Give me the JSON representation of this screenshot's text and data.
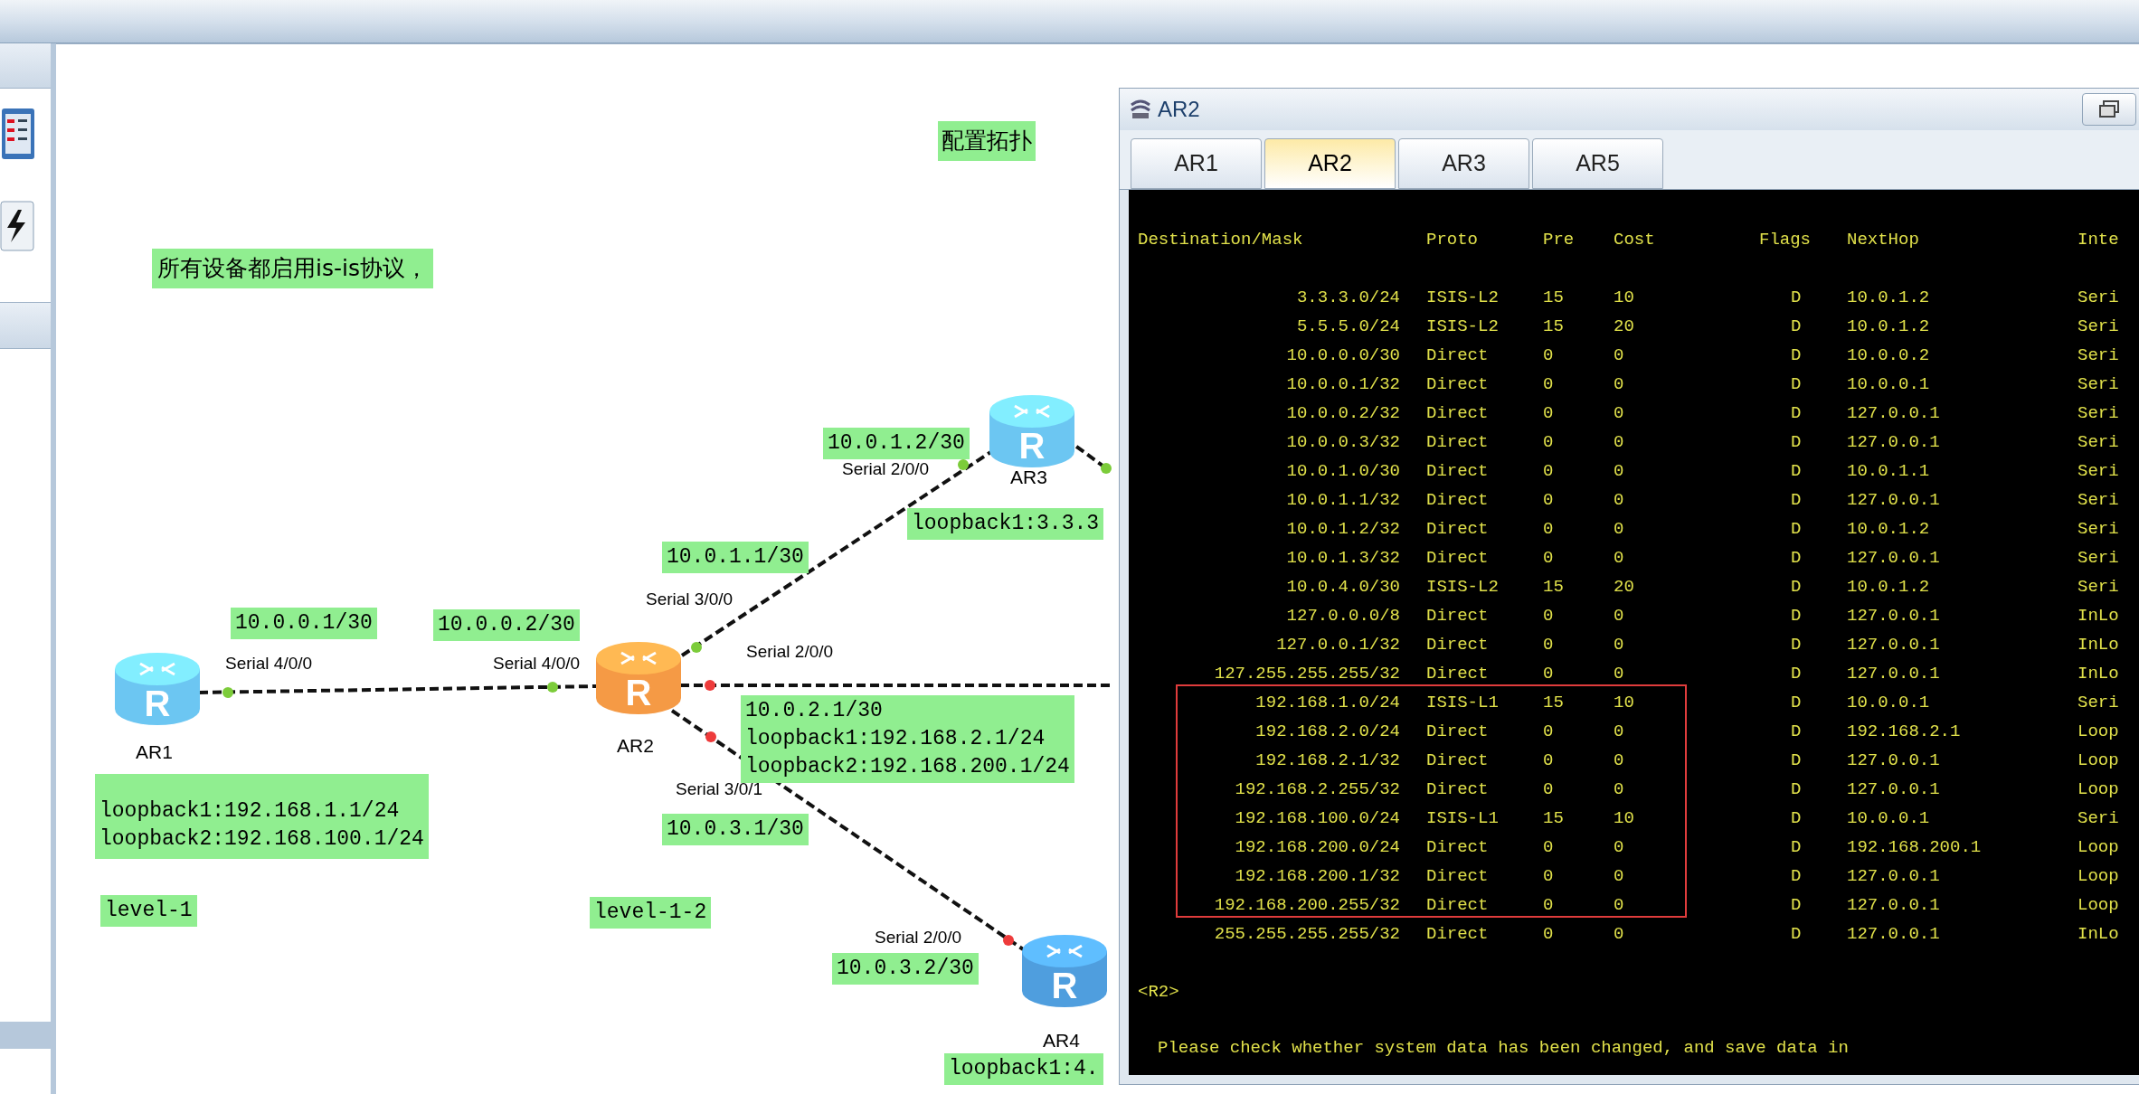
{
  "canvas": {
    "heading": "配置拓扑",
    "note": "所有设备都启用is-is协议，",
    "routers": [
      {
        "name": "AR1",
        "icon_letter": "R",
        "color": "#6cc6f2"
      },
      {
        "name": "AR2",
        "icon_letter": "R",
        "color": "#f59a45"
      },
      {
        "name": "AR3",
        "icon_letter": "R",
        "color": "#6cc6f2"
      },
      {
        "name": "AR4",
        "icon_letter": "R",
        "color": "#4f9ede"
      }
    ],
    "ports": [
      {
        "label": "Serial 4/0/0",
        "color": "#7ccc3a"
      },
      {
        "label": "Serial 4/0/0",
        "color": "#7ccc3a"
      },
      {
        "label": "Serial 3/0/0",
        "color": "#7ccc3a"
      },
      {
        "label": "Serial 2/0/0",
        "color": "#7ccc3a"
      },
      {
        "color": "#7ccc3a"
      },
      {
        "label": "Serial 2/0/0",
        "color": "#ee3b3b"
      },
      {
        "label": "Serial 3/0/1",
        "color": "#ee3b3b"
      },
      {
        "label": "Serial 2/0/0",
        "color": "#ee3b3b"
      }
    ],
    "labels": [
      {
        "lines": [
          "10.0.1.2/30"
        ]
      },
      {
        "lines": [
          "loopback1:3.3.3"
        ]
      },
      {
        "lines": [
          "10.0.1.1/30"
        ]
      },
      {
        "lines": [
          "10.0.0.1/30"
        ]
      },
      {
        "lines": [
          "10.0.0.2/30"
        ]
      },
      {
        "lines": [
          "10.0.2.1/30",
          "loopback1:192.168.2.1/24",
          "loopback2:192.168.200.1/24"
        ]
      },
      {
        "lines": [
          "10.0.3.1/30"
        ]
      },
      {
        "lines": [
          "loopback1:192.168.1.1/24",
          "loopback2:192.168.100.1/24"
        ]
      },
      {
        "lines": [
          "level-1"
        ]
      },
      {
        "lines": [
          "level-1-2"
        ]
      },
      {
        "lines": [
          "10.0.3.2/30"
        ]
      },
      {
        "lines": [
          "loopback1:4."
        ]
      }
    ]
  },
  "terminal": {
    "title": "AR2",
    "tabs": [
      {
        "label": "AR1",
        "selected": false
      },
      {
        "label": "AR2",
        "selected": true
      },
      {
        "label": "AR3",
        "selected": false
      },
      {
        "label": "AR5",
        "selected": false
      }
    ],
    "columns": [
      "Destination/Mask",
      "Proto",
      "Pre",
      "Cost",
      "Flags",
      "NextHop",
      "Inte"
    ],
    "route_blocks": [
      {
        "highlighted": false,
        "rows": [
          [
            "3.3.3.0/24",
            "ISIS-L2",
            "15",
            "10",
            "D",
            "10.0.1.2",
            "Seri"
          ],
          [
            "5.5.5.0/24",
            "ISIS-L2",
            "15",
            "20",
            "D",
            "10.0.1.2",
            "Seri"
          ],
          [
            "10.0.0.0/30",
            "Direct",
            "0",
            "0",
            "D",
            "10.0.0.2",
            "Seri"
          ],
          [
            "10.0.0.1/32",
            "Direct",
            "0",
            "0",
            "D",
            "10.0.0.1",
            "Seri"
          ],
          [
            "10.0.0.2/32",
            "Direct",
            "0",
            "0",
            "D",
            "127.0.0.1",
            "Seri"
          ],
          [
            "10.0.0.3/32",
            "Direct",
            "0",
            "0",
            "D",
            "127.0.0.1",
            "Seri"
          ],
          [
            "10.0.1.0/30",
            "Direct",
            "0",
            "0",
            "D",
            "10.0.1.1",
            "Seri"
          ],
          [
            "10.0.1.1/32",
            "Direct",
            "0",
            "0",
            "D",
            "127.0.0.1",
            "Seri"
          ],
          [
            "10.0.1.2/32",
            "Direct",
            "0",
            "0",
            "D",
            "10.0.1.2",
            "Seri"
          ],
          [
            "10.0.1.3/32",
            "Direct",
            "0",
            "0",
            "D",
            "127.0.0.1",
            "Seri"
          ],
          [
            "10.0.4.0/30",
            "ISIS-L2",
            "15",
            "20",
            "D",
            "10.0.1.2",
            "Seri"
          ],
          [
            "127.0.0.0/8",
            "Direct",
            "0",
            "0",
            "D",
            "127.0.0.1",
            "InLo"
          ],
          [
            "127.0.0.1/32",
            "Direct",
            "0",
            "0",
            "D",
            "127.0.0.1",
            "InLo"
          ],
          [
            "127.255.255.255/32",
            "Direct",
            "0",
            "0",
            "D",
            "127.0.0.1",
            "InLo"
          ]
        ]
      },
      {
        "highlighted": true,
        "rows": [
          [
            "192.168.1.0/24",
            "ISIS-L1",
            "15",
            "10",
            "D",
            "10.0.0.1",
            "Seri"
          ],
          [
            "192.168.2.0/24",
            "Direct",
            "0",
            "0",
            "D",
            "192.168.2.1",
            "Loop"
          ],
          [
            "192.168.2.1/32",
            "Direct",
            "0",
            "0",
            "D",
            "127.0.0.1",
            "Loop"
          ],
          [
            "192.168.2.255/32",
            "Direct",
            "0",
            "0",
            "D",
            "127.0.0.1",
            "Loop"
          ],
          [
            "192.168.100.0/24",
            "ISIS-L1",
            "15",
            "10",
            "D",
            "10.0.0.1",
            "Seri"
          ],
          [
            "192.168.200.0/24",
            "Direct",
            "0",
            "0",
            "D",
            "192.168.200.1",
            "Loop"
          ],
          [
            "192.168.200.1/32",
            "Direct",
            "0",
            "0",
            "D",
            "127.0.0.1",
            "Loop"
          ],
          [
            "192.168.200.255/32",
            "Direct",
            "0",
            "0",
            "D",
            "127.0.0.1",
            "Loop"
          ]
        ]
      },
      {
        "highlighted": false,
        "rows": [
          [
            "255.255.255.255/32",
            "Direct",
            "0",
            "0",
            "D",
            "127.0.0.1",
            "InLo"
          ]
        ]
      }
    ],
    "prompt": "<R2>",
    "message": "Please check whether system data has been changed, and save data in"
  }
}
